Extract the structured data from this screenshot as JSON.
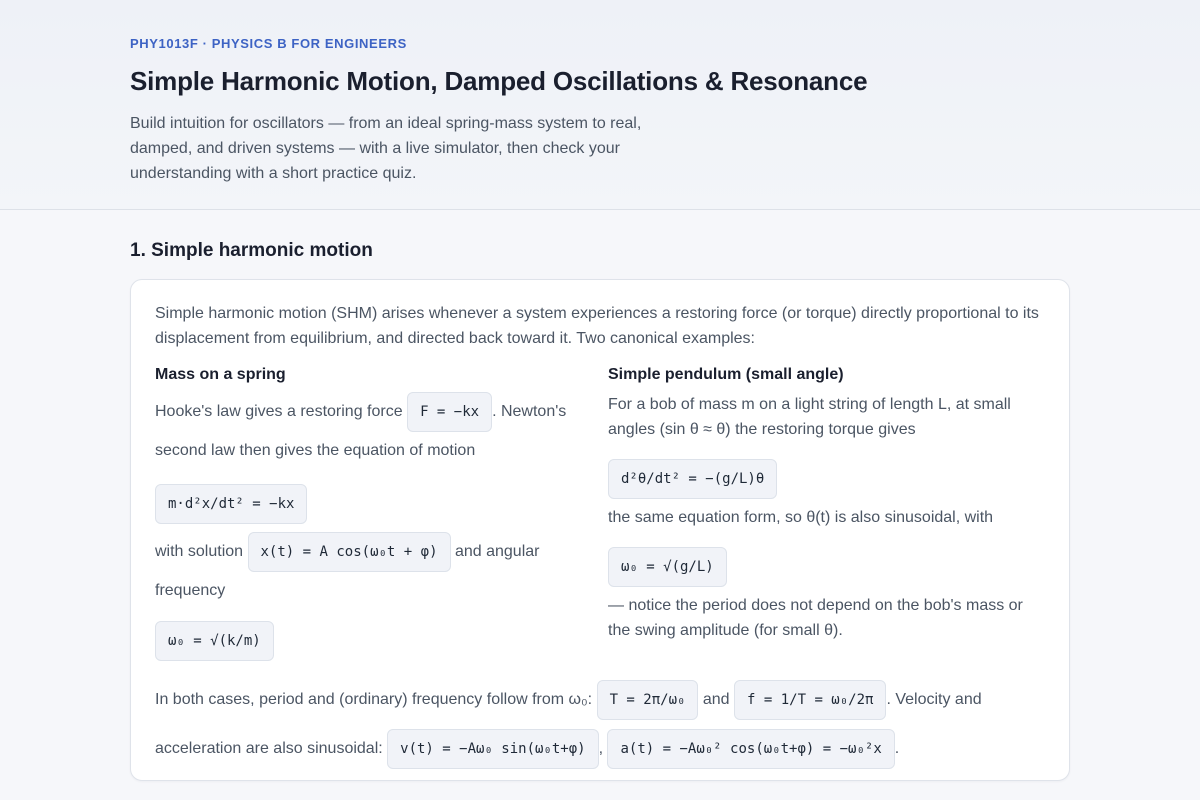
{
  "header": {
    "course_code": "PHY1013F · PHYSICS B FOR ENGINEERS",
    "title": "Simple Harmonic Motion, Damped Oscillations & Resonance",
    "intro": "Build intuition for oscillators — from an ideal spring-mass system to real, damped, and driven systems — with a live simulator, then check your understanding with a short practice quiz."
  },
  "section1": {
    "title": "1. Simple harmonic motion",
    "intro": "Simple harmonic motion (SHM) arises whenever a system experiences a restoring force (or torque) directly proportional to its displacement from equilibrium, and directed back toward it. Two canonical examples:",
    "spring": {
      "title": "Mass on a spring",
      "text1": "Hooke's law gives a restoring force ",
      "eq_force": "F = −kx",
      "text2": ". Newton's second law then gives the equation of motion",
      "eq_motion": "m·d²x/dt² = −kx",
      "text3": "with solution ",
      "eq_solution": "x(t) = A cos(ω₀t + φ)",
      "text4": " and angular frequency",
      "eq_omega": "ω₀ = √(k/m)"
    },
    "pendulum": {
      "title": "Simple pendulum (small angle)",
      "text1": "For a bob of mass m on a light string of length L, at small angles (sin θ ≈ θ) the restoring torque gives",
      "eq_motion": "d²θ/dt² = −(g/L)θ",
      "text2": "the same equation form, so θ(t) is also sinusoidal, with",
      "eq_omega": "ω₀ = √(g/L)",
      "text3": "— notice the period does not depend on the bob's mass or the swing amplitude (for small θ)."
    },
    "summary": {
      "text1": "In both cases, period and (ordinary) frequency follow from ω₀: ",
      "eq_period": "T = 2π/ω₀",
      "and": " and ",
      "eq_freq": "f = 1/T = ω₀/2π",
      "text2": ". Velocity and acceleration are also sinusoidal: ",
      "eq_velocity": "v(t) = −Aω₀ sin(ω₀t+φ)",
      "comma": ", ",
      "eq_accel": "a(t) = −Aω₀² cos(ω₀t+φ) = −ω₀²x",
      "period_end": "."
    }
  }
}
